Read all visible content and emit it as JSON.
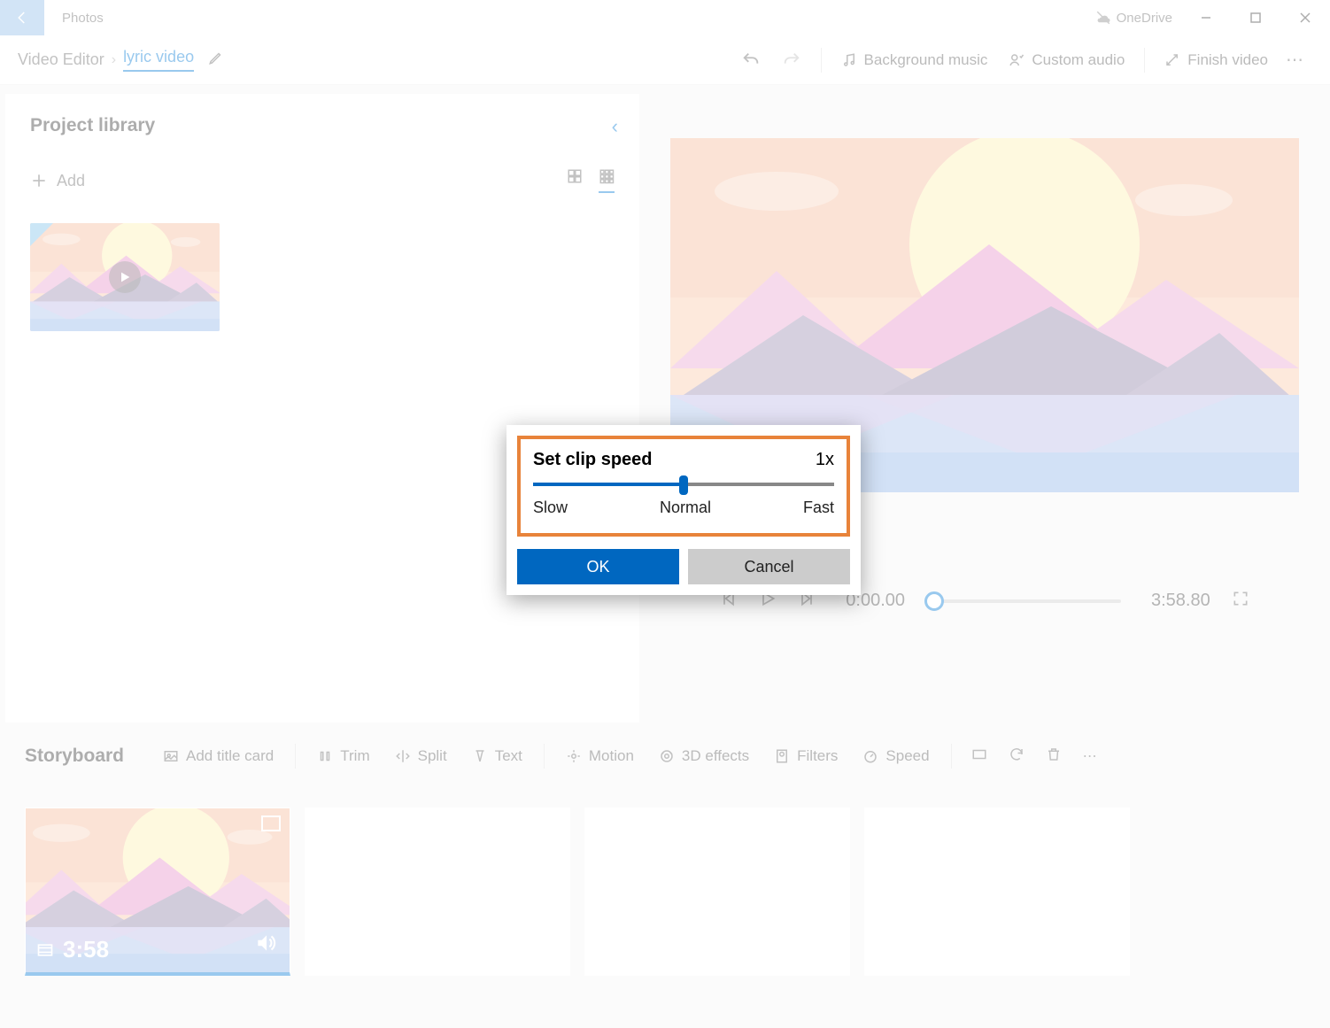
{
  "titlebar": {
    "app": "Photos",
    "onedrive": "OneDrive"
  },
  "cmdbar": {
    "crumb1": "Video Editor",
    "crumb2": "lyric video",
    "undo": "↶",
    "redo": "↷",
    "bgmusic": "Background music",
    "customaudio": "Custom audio",
    "finish": "Finish video"
  },
  "library": {
    "title": "Project library",
    "add": "Add"
  },
  "preview": {
    "current": "0:00.00",
    "total": "3:58.80"
  },
  "storyboard": {
    "title": "Storyboard",
    "titlecard": "Add title card",
    "trim": "Trim",
    "split": "Split",
    "text": "Text",
    "motion": "Motion",
    "fx3d": "3D effects",
    "filters": "Filters",
    "speed": "Speed",
    "clip_duration": "3:58"
  },
  "dialog": {
    "title": "Set clip speed",
    "value": "1x",
    "slow": "Slow",
    "normal": "Normal",
    "fast": "Fast",
    "ok": "OK",
    "cancel": "Cancel"
  }
}
